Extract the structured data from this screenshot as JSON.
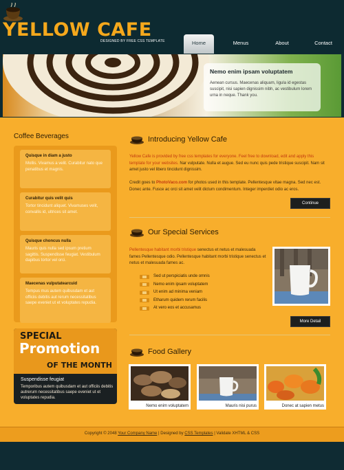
{
  "header": {
    "logo_title": "YELLOW CAFE",
    "logo_tagline": "DESIGNED BY FREE CSS TEMPLATE",
    "nav": [
      "Home",
      "Menus",
      "About",
      "Contact"
    ]
  },
  "banner": {
    "title": "Nemo enim ipsam voluptatem",
    "text": "Aenean cursus. Maecenas aliquam, ligula id egestas suscipit, nisi sapien dignissim nibh, ac vestibulum lorem urna in neque. Thank you."
  },
  "sidebar": {
    "title": "Coffee Beverages",
    "items": [
      {
        "title": "Quisque in diam a justo",
        "text": "Mollis. Vivamus a velit. Curabitur nato que penatibus et magnis."
      },
      {
        "title": "Curabitur quis velit quis",
        "text": "Tortor tincidunt aliquet. Vivamuses velit, convallis id, ultrices sit amet."
      },
      {
        "title": "Quisque choncus nulla",
        "text": "Mauris quis nulla sed ipsum pretium sagittis. Suspendisse feugiat. Vestibulum dapibus tortor vel orci."
      },
      {
        "title": "Maecenas vulputatearcuid",
        "text": "Tempus mus autem quibusdam et aut officiis debitis aut rerum necessitatibus saepe eveniet ut et voluptates repudia."
      }
    ],
    "promo": {
      "line1": "SPECIAL",
      "line2": "Promotion",
      "line3": "OF THE MONTH",
      "title": "Suspendisse feugiat",
      "text": "Temporibus autem quibusdam et aut officiis debitis autrerum necessitatibus saepe eveniet ut et voluptates repudia."
    }
  },
  "intro": {
    "heading": "Introducing Yellow Cafe",
    "para1_red": "Yellow Cafe is provided by free css templates for everyone. Feel free to download, edit and apply this template for your websites.",
    "para1_rest": " Nar vulputate. Nulla et augue. Sed eu nunc quis pede tristique suscipit. Nam sit amet justo vel libero tincidunt dignissim.",
    "para2_pre": "Credit goes to ",
    "para2_link": "PhotoVaco.com",
    "para2_post": " for photos used in this template. Pellentesque vitae magna. Sed nec est. Donec ante. Fusce ac orci sit amet velit dictum condimentum. Integer imperdiet odio ac eros.",
    "button": "Continue"
  },
  "services": {
    "heading": "Our Special Services",
    "text_red": "Pellentesque habitant morbi tristique",
    "text_rest": " senectus et netus et malesuada fames Pellentesque odio. Pellentesque habitant morbi tristique senectus et netus et malesuada fames ac.",
    "list": [
      "Sed ut perspiciatis unde omnis",
      "Nemo enim ipsam voluptatem",
      "Ut enim ad minima veniam",
      "Etharum quidem rerum facilis",
      "At vero eos et accusamus"
    ],
    "button": "More Detail"
  },
  "gallery": {
    "heading": "Food Gallery",
    "items": [
      "Nemo enim voluptatem",
      "Mauris nisi purus",
      "Donec at sapien metus"
    ]
  },
  "footer": {
    "pre": "Copyright © 2048 ",
    "company": "Your Company Name",
    "mid": " | Designed by ",
    "designer": "CSS Templates",
    "post": " | Validate XHTML & CSS"
  },
  "colors": {
    "header_bg": "#0d2a31",
    "content_bg": "#f8ae2c",
    "accent_orange": "#f5a81c",
    "link_red": "#c2390f"
  }
}
